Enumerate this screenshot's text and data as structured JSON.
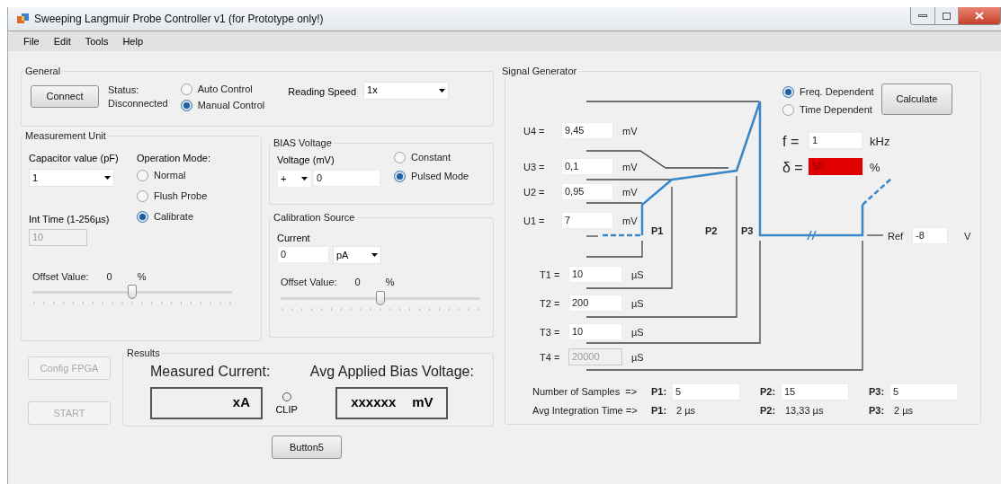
{
  "window": {
    "title": "Sweeping Langmuir Probe Controller v1 (for Prototype only!)"
  },
  "menu": [
    "File",
    "Edit",
    "Tools",
    "Help"
  ],
  "general": {
    "title": "General",
    "connect_button": "Connect",
    "status_label": "Status:",
    "status_value": "Disconnected",
    "control_modes": [
      {
        "label": "Auto Control",
        "selected": false
      },
      {
        "label": "Manual Control",
        "selected": true
      }
    ],
    "reading_speed": {
      "label": "Reading Speed",
      "value": "1x"
    }
  },
  "measurement_unit": {
    "title": "Measurement Unit",
    "capacitor": {
      "label": "Capacitor value (pF)",
      "value": "1"
    },
    "int_time": {
      "label": "Int Time (1-256µs)",
      "value": "10",
      "disabled": true
    },
    "operation_mode": {
      "label": "Operation Mode:",
      "options": [
        {
          "label": "Normal",
          "selected": false
        },
        {
          "label": "Flush Probe",
          "selected": false
        },
        {
          "label": "Calibrate",
          "selected": true
        }
      ]
    },
    "offset": {
      "label": "Offset Value:",
      "value": "0",
      "unit": "%",
      "level": 0.5
    }
  },
  "bias_voltage": {
    "title": "BIAS Voltage",
    "voltage_label": "Voltage (mV)",
    "sign": "+",
    "value": "0",
    "modes": [
      {
        "label": "Constant",
        "selected": false
      },
      {
        "label": "Pulsed Mode",
        "selected": true
      }
    ]
  },
  "calibration_source": {
    "title": "Calibration Source",
    "current_label": "Current",
    "current_value": "0",
    "unit": "pA",
    "offset": {
      "label": "Offset Value:",
      "value": "0",
      "unit": "%",
      "level": 0.5
    }
  },
  "side_buttons": [
    {
      "label": "Config FPGA",
      "disabled": true
    },
    {
      "label": "START",
      "disabled": true
    }
  ],
  "results": {
    "title": "Results",
    "measured_current": {
      "label": "Measured Current:",
      "value": "xA"
    },
    "clip": {
      "label": "CLIP",
      "on": false
    },
    "bias": {
      "label": "Avg Applied Bias Voltage:",
      "value": "xxxxxx",
      "unit": "mV"
    }
  },
  "bottom_button": "Button5",
  "signal_generator": {
    "title": "Signal Generator",
    "voltages": [
      {
        "label": "U4 =",
        "value": "9,45",
        "unit": "mV"
      },
      {
        "label": "U3 =",
        "value": "0,1",
        "unit": "mV"
      },
      {
        "label": "U2 =",
        "value": "0,95",
        "unit": "mV"
      },
      {
        "label": "U1 =",
        "value": "7",
        "unit": "mV"
      }
    ],
    "times": [
      {
        "label": "T1 =",
        "value": "10",
        "unit": "µS",
        "disabled": false
      },
      {
        "label": "T2 =",
        "value": "200",
        "unit": "µS",
        "disabled": false
      },
      {
        "label": "T3 =",
        "value": "10",
        "unit": "µS",
        "disabled": false
      },
      {
        "label": "T4 =",
        "value": "20000",
        "unit": "µS",
        "disabled": true
      }
    ],
    "phase_labels": [
      "P1",
      "P2",
      "P3"
    ],
    "timing_modes": [
      {
        "label": "Freq. Dependent",
        "selected": true
      },
      {
        "label": "Time Dependent",
        "selected": false
      }
    ],
    "calculate_button": "Calculate",
    "frequency": {
      "label": "f =",
      "value": "1",
      "unit": "kHz",
      "invalid": false
    },
    "duty": {
      "label": "δ =",
      "value": "50",
      "unit": "%",
      "invalid": true
    },
    "ref": {
      "label": "Ref",
      "value": "-8",
      "unit": "V"
    },
    "samples": {
      "label": "Number of Samples  =>",
      "items": [
        {
          "label": "P1:",
          "value": "5"
        },
        {
          "label": "P2:",
          "value": "15"
        },
        {
          "label": "P3:",
          "value": "5"
        }
      ]
    },
    "integration": {
      "label": "Avg Integration Time =>",
      "items": [
        {
          "label": "P1:",
          "value": "2 µs"
        },
        {
          "label": "P2:",
          "value": "13,33 µs"
        },
        {
          "label": "P3:",
          "value": "2 µs"
        }
      ]
    }
  }
}
